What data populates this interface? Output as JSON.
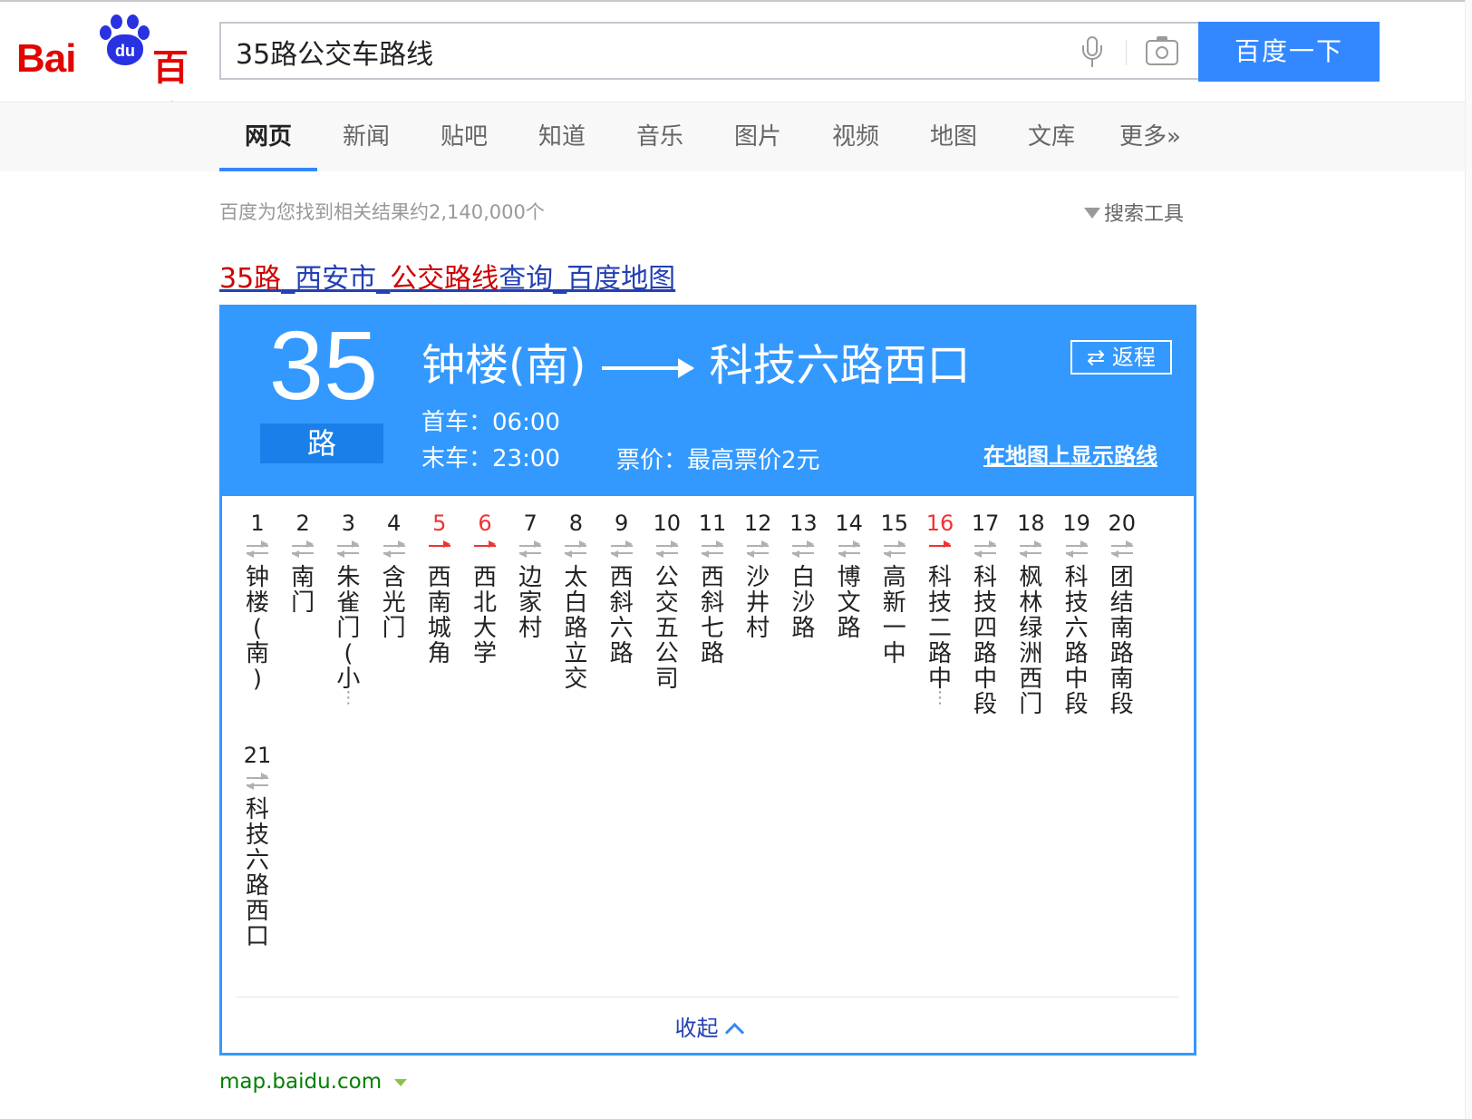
{
  "search": {
    "query": "35路公交车路线",
    "button_label": "百度一下"
  },
  "logo": {
    "latin": "Bai",
    "paw_text": "du",
    "chinese": "百度"
  },
  "tabs": [
    {
      "label": "网页",
      "active": true
    },
    {
      "label": "新闻"
    },
    {
      "label": "贴吧"
    },
    {
      "label": "知道"
    },
    {
      "label": "音乐"
    },
    {
      "label": "图片"
    },
    {
      "label": "视频"
    },
    {
      "label": "地图"
    },
    {
      "label": "文库"
    },
    {
      "label": "更多»"
    }
  ],
  "result_count": "百度为您找到相关结果约2,140,000个",
  "search_tools": "搜索工具",
  "result": {
    "title_parts": [
      {
        "text": "35路",
        "em": true
      },
      {
        "text": "_西安市_",
        "em": false
      },
      {
        "text": "公交路线",
        "em": true
      },
      {
        "text": "查询_百度地图",
        "em": false
      }
    ],
    "url": "map.baidu.com"
  },
  "bus": {
    "number": "35",
    "suffix": "路",
    "from": "钟楼(南)",
    "to": "科技六路西口",
    "return_label": "⇄ 返程",
    "first_bus": "首车：06:00",
    "last_bus": "末车：23:00",
    "price": "票价：最高票价2元",
    "show_map": "在地图上显示路线",
    "collapse_label": "收起",
    "stops": [
      {
        "n": "1",
        "name": "钟楼(南)",
        "red": false,
        "more": false
      },
      {
        "n": "2",
        "name": "南门",
        "red": false,
        "more": false
      },
      {
        "n": "3",
        "name": "朱雀门(小",
        "red": false,
        "more": true
      },
      {
        "n": "4",
        "name": "含光门",
        "red": false,
        "more": false
      },
      {
        "n": "5",
        "name": "西南城角",
        "red": true,
        "more": false
      },
      {
        "n": "6",
        "name": "西北大学",
        "red": true,
        "more": false
      },
      {
        "n": "7",
        "name": "边家村",
        "red": false,
        "more": false
      },
      {
        "n": "8",
        "name": "太白路立交",
        "red": false,
        "more": false
      },
      {
        "n": "9",
        "name": "西斜六路",
        "red": false,
        "more": false
      },
      {
        "n": "10",
        "name": "公交五公司",
        "red": false,
        "more": false
      },
      {
        "n": "11",
        "name": "西斜七路",
        "red": false,
        "more": false
      },
      {
        "n": "12",
        "name": "沙井村",
        "red": false,
        "more": false
      },
      {
        "n": "13",
        "name": "白沙路",
        "red": false,
        "more": false
      },
      {
        "n": "14",
        "name": "博文路",
        "red": false,
        "more": false
      },
      {
        "n": "15",
        "name": "高新一中",
        "red": false,
        "more": false
      },
      {
        "n": "16",
        "name": "科技二路中",
        "red": true,
        "more": true
      },
      {
        "n": "17",
        "name": "科技四路中段",
        "red": false,
        "more": false
      },
      {
        "n": "18",
        "name": "枫林绿洲西门",
        "red": false,
        "more": false
      },
      {
        "n": "19",
        "name": "科技六路中段",
        "red": false,
        "more": false
      },
      {
        "n": "20",
        "name": "团结南路南段",
        "red": false,
        "more": false
      },
      {
        "n": "21",
        "name": "科技六路西口",
        "red": false,
        "more": false
      }
    ]
  },
  "colors": {
    "accent": "#3388ff",
    "card_blue": "#3399ff",
    "red_stop": "#ee3333",
    "link_blue": "#2440b3",
    "url_green": "#008000"
  }
}
